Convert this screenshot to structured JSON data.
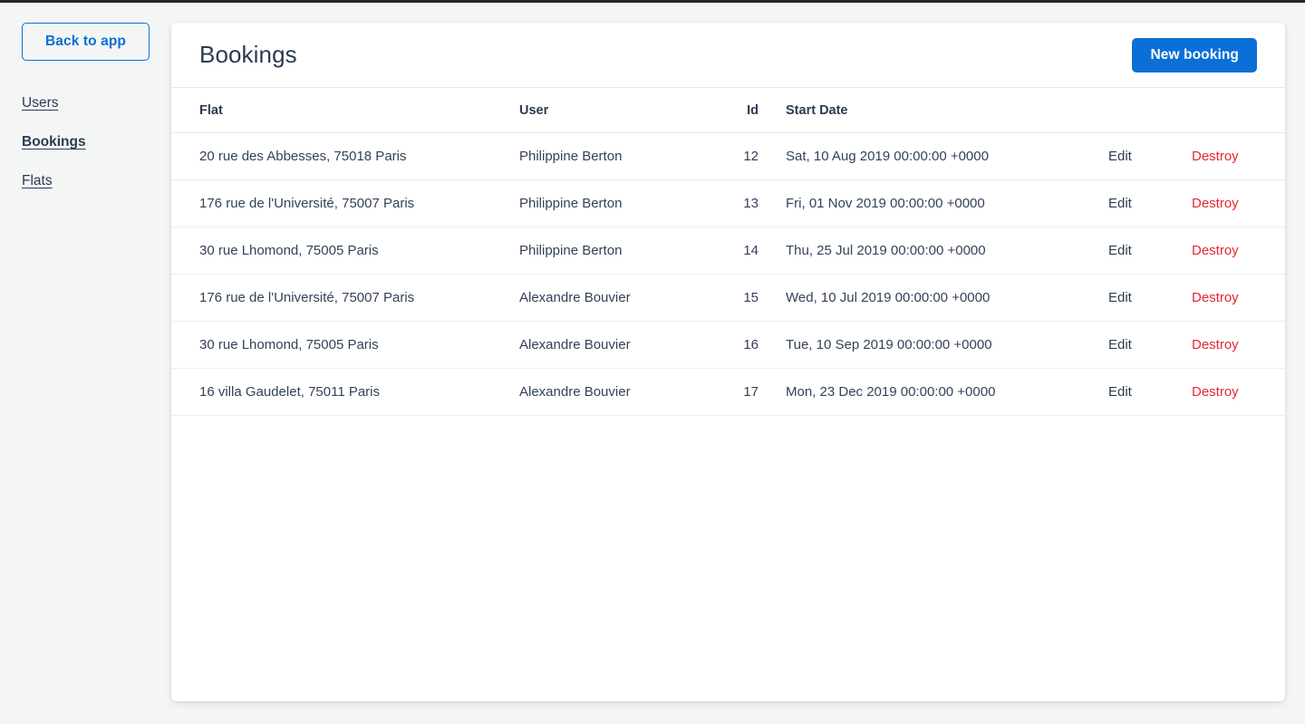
{
  "theme": {
    "page_background": "#f4f6f6",
    "card_background": "#ffffff",
    "accent_blue": "#0b6fd8",
    "text_navy": "#2b3b52",
    "danger_red": "#e8262c",
    "border_gray": "#e7e9ec"
  },
  "sidebar": {
    "back_button_label": "Back to app",
    "items": [
      {
        "label": "Users",
        "active": false
      },
      {
        "label": "Bookings",
        "active": true
      },
      {
        "label": "Flats",
        "active": false
      }
    ]
  },
  "main": {
    "title": "Bookings",
    "new_button_label": "New booking",
    "table": {
      "columns": [
        "Flat",
        "User",
        "Id",
        "Start Date",
        "",
        ""
      ],
      "edit_label": "Edit",
      "destroy_label": "Destroy",
      "rows": [
        {
          "flat": "20 rue des Abbesses, 75018 Paris",
          "user": "Philippine Berton",
          "id": "12",
          "start_date": "Sat, 10 Aug 2019 00:00:00 +0000",
          "edit": "Edit",
          "destroy": "Destroy"
        },
        {
          "flat": "176 rue de l'Université, 75007 Paris",
          "user": "Philippine Berton",
          "id": "13",
          "start_date": "Fri, 01 Nov 2019 00:00:00 +0000",
          "edit": "Edit",
          "destroy": "Destroy"
        },
        {
          "flat": "30 rue Lhomond, 75005 Paris",
          "user": "Philippine Berton",
          "id": "14",
          "start_date": "Thu, 25 Jul 2019 00:00:00 +0000",
          "edit": "Edit",
          "destroy": "Destroy"
        },
        {
          "flat": "176 rue de l'Université, 75007 Paris",
          "user": "Alexandre Bouvier",
          "id": "15",
          "start_date": "Wed, 10 Jul 2019 00:00:00 +0000",
          "edit": "Edit",
          "destroy": "Destroy"
        },
        {
          "flat": "30 rue Lhomond, 75005 Paris",
          "user": "Alexandre Bouvier",
          "id": "16",
          "start_date": "Tue, 10 Sep 2019 00:00:00 +0000",
          "edit": "Edit",
          "destroy": "Destroy"
        },
        {
          "flat": "16 villa Gaudelet, 75011 Paris",
          "user": "Alexandre Bouvier",
          "id": "17",
          "start_date": "Mon, 23 Dec 2019 00:00:00 +0000",
          "edit": "Edit",
          "destroy": "Destroy"
        }
      ]
    }
  }
}
